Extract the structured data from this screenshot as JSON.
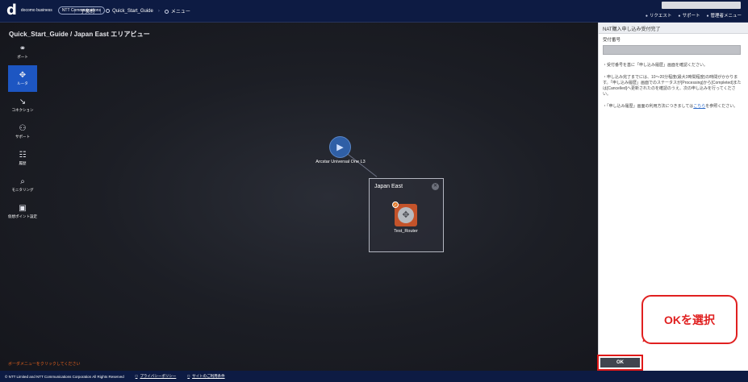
{
  "header": {
    "logo_mark": "d",
    "logo_text": "docomo business",
    "ntt_logo": "NTT Communications",
    "breadcrumbs": [
      "子契約",
      "Quick_Start_Guide",
      "メニュー"
    ],
    "menu": [
      "リクエスト",
      "サポート",
      "管理者メニュー"
    ]
  },
  "main": {
    "area_title": "Quick_Start_Guide / Japan East エリアビュー",
    "nav": [
      {
        "label": "ポート",
        "icon": "port-icon",
        "glyph": "⚭"
      },
      {
        "label": "ルータ",
        "icon": "router-icon",
        "glyph": "✥"
      },
      {
        "label": "コネクション",
        "icon": "connection-icon",
        "glyph": "↘"
      },
      {
        "label": "サポート",
        "icon": "support-icon",
        "glyph": "⚇"
      },
      {
        "label": "履歴",
        "icon": "history-icon",
        "glyph": "☷"
      },
      {
        "label": "モニタリング",
        "icon": "monitoring-icon",
        "glyph": "⌕"
      },
      {
        "label": "仮想ポイント設定",
        "icon": "virtual-point-icon",
        "glyph": "▣"
      }
    ],
    "hint": "ボーダメニューをクリックしてください",
    "topology": {
      "cloud_label": "Arcstar Universal One L3",
      "region_title": "Japan East",
      "router_label": "Test_Router"
    }
  },
  "panel": {
    "title": "NAT購入申し込み受付完了",
    "field_label": "受付番号",
    "note1": "・受付番号を基に「申し込み履歴」画面を確認ください。",
    "note2": "・申し込み完了までには、10〜20分程度(最大3時間程度)の時間がかかります。「申し込み履歴」画面でのステータスが[Processing]から[Completed]または[Cancelled]へ更新されたのを確認のうえ、次の申し込みを行ってください。",
    "note3_pre": "・「申し込み履歴」画面の利用方法につきましては",
    "note3_link": "こちら",
    "note3_post": "を参照ください。",
    "ok_label": "OK"
  },
  "callout": "OKを選択",
  "footer": {
    "copyright": "© NTT Limited and NTT Communications Corporation All Rights Reserved",
    "privacy": "プライバシーポリシー",
    "site_usage": "サイトのご利用条件"
  }
}
